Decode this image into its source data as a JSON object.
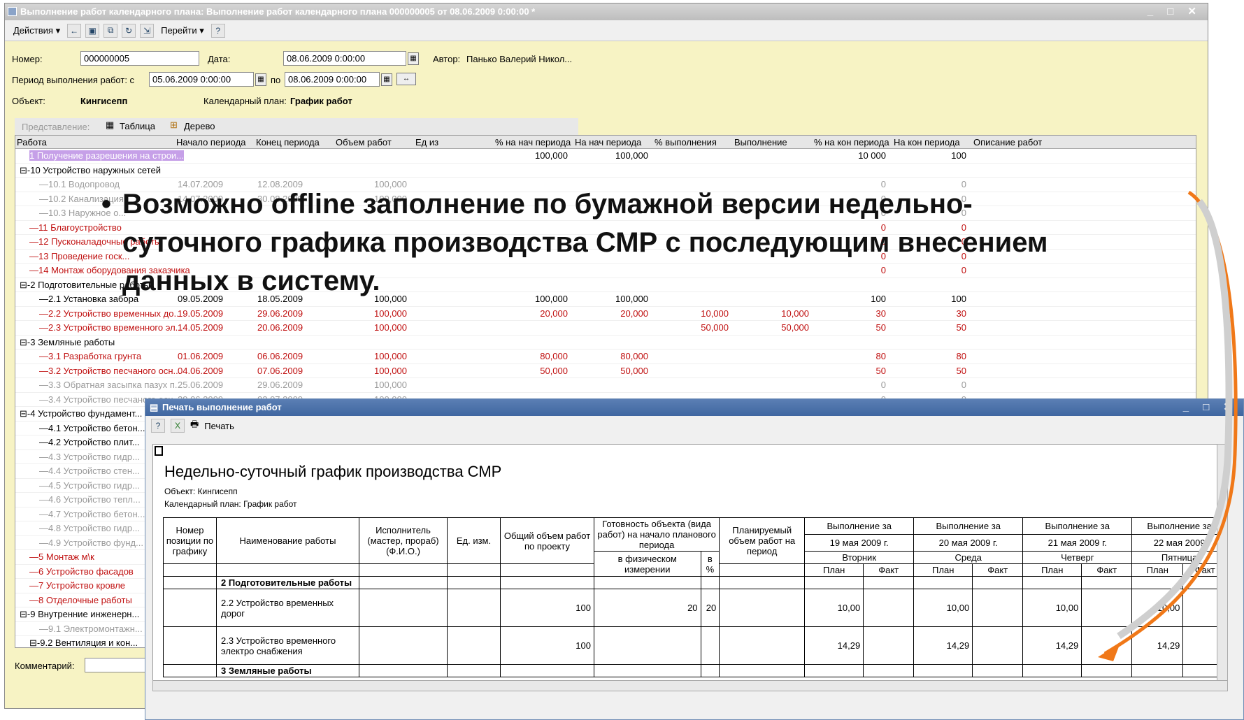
{
  "main_window": {
    "title": "Выполнение работ календарного плана: Выполнение работ календарного плана 000000005 от 08.06.2009 0:00:00 *",
    "toolbar": {
      "actions": "Действия ▾",
      "goto": "Перейти ▾",
      "help": "?"
    },
    "number_label": "Номер:",
    "number_value": "000000005",
    "date_label": "Дата:",
    "date_value": "08.06.2009 0:00:00",
    "author_label": "Автор:",
    "author_value": "Панько Валерий Никол...",
    "period_label": "Период выполнения работ: с",
    "period_from": "05.06.2009 0:00:00",
    "period_to_label": "по",
    "period_to": "08.06.2009 0:00:00",
    "object_label": "Объект:",
    "object_value": "Кингисепп",
    "plan_label": "Календарный план:",
    "plan_value": "График работ",
    "view_label": "Представление:",
    "tab_table": "Таблица",
    "tab_tree": "Дерево",
    "comment_label": "Комментарий:"
  },
  "grid": {
    "headers": [
      "Работа",
      "Начало периода",
      "Конец периода",
      "Объем работ",
      "Ед из",
      "% на нач периода",
      "На нач периода",
      "% выполнения",
      "Выполнение",
      "% на кон периода",
      "На кон периода",
      "Описание работ"
    ],
    "rows": [
      {
        "style": "hl",
        "indent": 1,
        "name": "1 Получение разрешения на строи...",
        "start": "",
        "end": "",
        "vol": "",
        "pct_s": "100,000",
        "s": "100,000",
        "pct": "",
        "done": "",
        "pct_e": "10 000",
        "e": "100"
      },
      {
        "style": "",
        "indent": 0,
        "name": "⊟-10 Устройство наружных сетей",
        "start": "",
        "end": "",
        "vol": "",
        "pct_s": "",
        "s": "",
        "pct": "",
        "done": "",
        "pct_e": "",
        "e": ""
      },
      {
        "style": "gray",
        "indent": 2,
        "name": "10.1 Водопровод",
        "start": "14.07.2009",
        "end": "12.08.2009",
        "vol": "100,000",
        "pct_s": "",
        "s": "",
        "pct": "",
        "done": "",
        "pct_e": "0",
        "e": "0"
      },
      {
        "style": "gray",
        "indent": 2,
        "name": "10.2 Канализация",
        "start": "14.07.2009",
        "end": "30.08.2009",
        "vol": "100,000",
        "pct_s": "",
        "s": "",
        "pct": "",
        "done": "",
        "pct_e": "0",
        "e": "0"
      },
      {
        "style": "gray",
        "indent": 2,
        "name": "10.3 Наружное о...",
        "start": "",
        "end": "",
        "vol": "",
        "pct_s": "",
        "s": "",
        "pct": "",
        "done": "",
        "pct_e": "0",
        "e": "0"
      },
      {
        "style": "red",
        "indent": 1,
        "name": "11 Благоустройство",
        "start": "",
        "end": "",
        "vol": "",
        "pct_s": "",
        "s": "",
        "pct": "",
        "done": "",
        "pct_e": "0",
        "e": "0"
      },
      {
        "style": "red",
        "indent": 1,
        "name": "12 Пусконаладочные работы",
        "start": "",
        "end": "",
        "vol": "",
        "pct_s": "",
        "s": "",
        "pct": "",
        "done": "",
        "pct_e": "0",
        "e": "0"
      },
      {
        "style": "red",
        "indent": 1,
        "name": "13 Проведение госк...",
        "start": "",
        "end": "",
        "vol": "",
        "pct_s": "",
        "s": "",
        "pct": "",
        "done": "",
        "pct_e": "0",
        "e": "0"
      },
      {
        "style": "red",
        "indent": 1,
        "name": "14 Монтаж оборудования заказчика",
        "start": "",
        "end": "",
        "vol": "",
        "pct_s": "",
        "s": "",
        "pct": "",
        "done": "",
        "pct_e": "0",
        "e": "0"
      },
      {
        "style": "",
        "indent": 0,
        "name": "⊟-2 Подготовительные работы",
        "start": "",
        "end": "",
        "vol": "",
        "pct_s": "",
        "s": "",
        "pct": "",
        "done": "",
        "pct_e": "",
        "e": ""
      },
      {
        "style": "",
        "indent": 2,
        "name": "2.1 Установка забора",
        "start": "09.05.2009",
        "end": "18.05.2009",
        "vol": "100,000",
        "pct_s": "100,000",
        "s": "100,000",
        "pct": "",
        "done": "",
        "pct_e": "100",
        "e": "100"
      },
      {
        "style": "red",
        "indent": 2,
        "name": "2.2 Устройство временных до...",
        "start": "19.05.2009",
        "end": "29.06.2009",
        "vol": "100,000",
        "pct_s": "20,000",
        "s": "20,000",
        "pct": "10,000",
        "done": "10,000",
        "pct_e": "30",
        "e": "30"
      },
      {
        "style": "red",
        "indent": 2,
        "name": "2.3 Устройство временного эл...",
        "start": "14.05.2009",
        "end": "20.06.2009",
        "vol": "100,000",
        "pct_s": "",
        "s": "",
        "pct": "50,000",
        "done": "50,000",
        "pct_e": "50",
        "e": "50"
      },
      {
        "style": "",
        "indent": 0,
        "name": "⊟-3 Земляные работы",
        "start": "",
        "end": "",
        "vol": "",
        "pct_s": "",
        "s": "",
        "pct": "",
        "done": "",
        "pct_e": "",
        "e": ""
      },
      {
        "style": "red",
        "indent": 2,
        "name": "3.1 Разработка грунта",
        "start": "01.06.2009",
        "end": "06.06.2009",
        "vol": "100,000",
        "pct_s": "80,000",
        "s": "80,000",
        "pct": "",
        "done": "",
        "pct_e": "80",
        "e": "80"
      },
      {
        "style": "red",
        "indent": 2,
        "name": "3.2 Устройство песчаного осн...",
        "start": "04.06.2009",
        "end": "07.06.2009",
        "vol": "100,000",
        "pct_s": "50,000",
        "s": "50,000",
        "pct": "",
        "done": "",
        "pct_e": "50",
        "e": "50"
      },
      {
        "style": "gray",
        "indent": 2,
        "name": "3.3 Обратная засыпка пазух п...",
        "start": "25.06.2009",
        "end": "29.06.2009",
        "vol": "100,000",
        "pct_s": "",
        "s": "",
        "pct": "",
        "done": "",
        "pct_e": "0",
        "e": "0"
      },
      {
        "style": "gray",
        "indent": 2,
        "name": "3.4 Устройство песчаного осн...",
        "start": "29.06.2009",
        "end": "02.07.2009",
        "vol": "100,000",
        "pct_s": "",
        "s": "",
        "pct": "",
        "done": "",
        "pct_e": "0",
        "e": "0"
      },
      {
        "style": "",
        "indent": 0,
        "name": "⊟-4 Устройство фундамент...",
        "start": "",
        "end": "",
        "vol": "",
        "pct_s": "",
        "s": "",
        "pct": "",
        "done": "",
        "pct_e": "",
        "e": ""
      },
      {
        "style": "",
        "indent": 2,
        "name": "4.1 Устройство бетон...",
        "start": "",
        "end": "",
        "vol": "",
        "pct_s": "",
        "s": "",
        "pct": "",
        "done": "",
        "pct_e": "",
        "e": ""
      },
      {
        "style": "",
        "indent": 2,
        "name": "4.2 Устройство плит...",
        "start": "",
        "end": "",
        "vol": "",
        "pct_s": "",
        "s": "",
        "pct": "",
        "done": "",
        "pct_e": "",
        "e": ""
      },
      {
        "style": "gray",
        "indent": 2,
        "name": "4.3 Устройство гидр...",
        "start": "",
        "end": "",
        "vol": "",
        "pct_s": "",
        "s": "",
        "pct": "",
        "done": "",
        "pct_e": "",
        "e": ""
      },
      {
        "style": "gray",
        "indent": 2,
        "name": "4.4 Устройство стен...",
        "start": "",
        "end": "",
        "vol": "",
        "pct_s": "",
        "s": "",
        "pct": "",
        "done": "",
        "pct_e": "",
        "e": ""
      },
      {
        "style": "gray",
        "indent": 2,
        "name": "4.5 Устройство гидр...",
        "start": "",
        "end": "",
        "vol": "",
        "pct_s": "",
        "s": "",
        "pct": "",
        "done": "",
        "pct_e": "",
        "e": ""
      },
      {
        "style": "gray",
        "indent": 2,
        "name": "4.6 Устройство тепл...",
        "start": "",
        "end": "",
        "vol": "",
        "pct_s": "",
        "s": "",
        "pct": "",
        "done": "",
        "pct_e": "",
        "e": ""
      },
      {
        "style": "gray",
        "indent": 2,
        "name": "4.7 Устройство бетон...",
        "start": "",
        "end": "",
        "vol": "",
        "pct_s": "",
        "s": "",
        "pct": "",
        "done": "",
        "pct_e": "",
        "e": ""
      },
      {
        "style": "gray",
        "indent": 2,
        "name": "4.8 Устройство гидр...",
        "start": "",
        "end": "",
        "vol": "",
        "pct_s": "",
        "s": "",
        "pct": "",
        "done": "",
        "pct_e": "",
        "e": ""
      },
      {
        "style": "gray",
        "indent": 2,
        "name": "4.9 Устройство фунд...",
        "start": "",
        "end": "",
        "vol": "",
        "pct_s": "",
        "s": "",
        "pct": "",
        "done": "",
        "pct_e": "",
        "e": ""
      },
      {
        "style": "red",
        "indent": 1,
        "name": "5 Монтаж м\\к",
        "start": "",
        "end": "",
        "vol": "",
        "pct_s": "",
        "s": "",
        "pct": "",
        "done": "",
        "pct_e": "",
        "e": ""
      },
      {
        "style": "red",
        "indent": 1,
        "name": "6 Устройство фасадов",
        "start": "",
        "end": "",
        "vol": "",
        "pct_s": "",
        "s": "",
        "pct": "",
        "done": "",
        "pct_e": "",
        "e": ""
      },
      {
        "style": "red",
        "indent": 1,
        "name": "7 Устройство кровле",
        "start": "",
        "end": "",
        "vol": "",
        "pct_s": "",
        "s": "",
        "pct": "",
        "done": "",
        "pct_e": "",
        "e": ""
      },
      {
        "style": "red",
        "indent": 1,
        "name": "8 Отделочные работы",
        "start": "",
        "end": "",
        "vol": "",
        "pct_s": "",
        "s": "",
        "pct": "",
        "done": "",
        "pct_e": "",
        "e": ""
      },
      {
        "style": "",
        "indent": 0,
        "name": "⊟-9 Внутренние инженерн...",
        "start": "",
        "end": "",
        "vol": "",
        "pct_s": "",
        "s": "",
        "pct": "",
        "done": "",
        "pct_e": "",
        "e": ""
      },
      {
        "style": "gray",
        "indent": 2,
        "name": "9.1 Электромонтажн...",
        "start": "",
        "end": "",
        "vol": "",
        "pct_s": "",
        "s": "",
        "pct": "",
        "done": "",
        "pct_e": "",
        "e": ""
      },
      {
        "style": "",
        "indent": 1,
        "name": "⊟-9.2 Вентиляция и кон...",
        "start": "",
        "end": "",
        "vol": "",
        "pct_s": "",
        "s": "",
        "pct": "",
        "done": "",
        "pct_e": "",
        "e": ""
      }
    ]
  },
  "overlay": {
    "bullet": "•",
    "line1": "Возможно offline заполнение по бумажной версии недельно-",
    "line2": "суточного графика производства СМР с последующим внесением",
    "line3": "данных в систему."
  },
  "popup": {
    "title": "Печать выполнение работ",
    "print_label": "Печать",
    "report_title": "Недельно-суточный график производства СМР",
    "object_line": "Объект: Кингисепп",
    "plan_line": "Календарный план: График работ",
    "table": {
      "h_num": "Номер позиции по графику",
      "h_name": "Наименование работы",
      "h_exec": "Исполнитель (мастер, прораб) (Ф.И.О.)",
      "h_unit": "Ед. изм.",
      "h_total": "Общий объем работ по проекту",
      "h_ready": "Готовность объекта (вида работ) на начало планового периода",
      "h_ready_phys": "в физическом измерении",
      "h_ready_pct": "в %",
      "h_planned": "Планируемый объем работ на период",
      "h_exec_for": "Выполнение за",
      "days": [
        {
          "date": "19 мая 2009 г.",
          "weekday": "Вторник"
        },
        {
          "date": "20 мая 2009 г.",
          "weekday": "Среда"
        },
        {
          "date": "21 мая 2009 г.",
          "weekday": "Четверг"
        },
        {
          "date": "22 мая 2009",
          "weekday": "Пятница"
        }
      ],
      "plan": "План",
      "fact": "Факт",
      "section1": "2 Подготовительные работы",
      "row1_name": "2.2 Устройство временных дорог",
      "row1_total": "100",
      "row1_phys": "20",
      "row1_pct": "20",
      "row1_plan": "10,00",
      "row2_name": "2.3 Устройство временного электро снабжения",
      "row2_total": "100",
      "row2_plan": "14,29",
      "section2": "3 Земляные работы"
    }
  },
  "colors": {
    "form_bg": "#f7f3c4",
    "accent_arrow": "#f07818",
    "red_text": "#c01010"
  }
}
